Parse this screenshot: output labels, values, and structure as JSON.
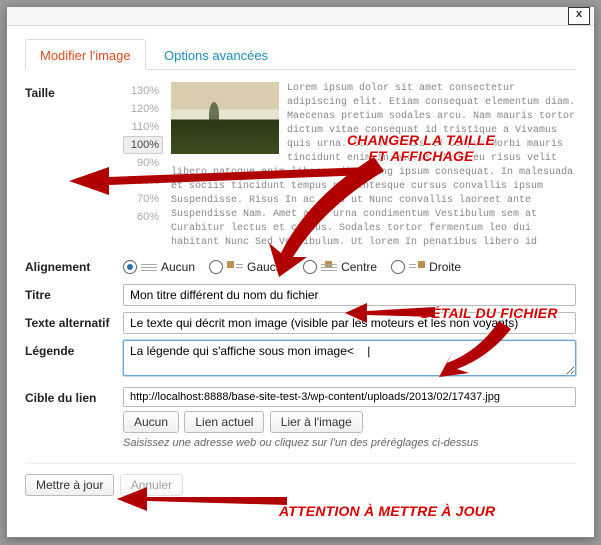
{
  "dialog": {
    "close_label": "x"
  },
  "tabs": {
    "edit": "Modifier l'image",
    "advanced": "Options avancées"
  },
  "taille": {
    "label": "Taille",
    "sizes": [
      "130%",
      "120%",
      "110%",
      "100%",
      "90%",
      "80%",
      "70%",
      "60%"
    ],
    "selected": "100%",
    "lorem": "Lorem ipsum dolor sit amet consectetur adipiscing elit. Etiam consequat elementum diam. Maecenas pretium sodales arcu. Nam mauris tortor dictum vitae consequat id tristique a Vivamus quis urna. Sed et felis id tempus Morbi mauris tincidunt enim In mauris. Pede eu risus velit libero natoque enim libero adipiscing ipsum consequat. In malesuada et sociis tincidunt tempus pellentesque cursus convallis ipsum Suspendisse. Risus In ac quis ut Nunc convallis laoreet ante Suspendisse Nam. Amet amet urna condimentum Vestibulum sem at Curabitur lectus et cursus. Sodales tortor fermentum leo dui habitant Nunc Sed Vestibulum. Ut lorem In penatibus libero id"
  },
  "alignement": {
    "label": "Alignement",
    "options": {
      "none": "Aucun",
      "left": "Gauche",
      "center": "Centre",
      "right": "Droite"
    },
    "selected": "none"
  },
  "titre": {
    "label": "Titre",
    "value": "Mon titre différent du nom du fichier"
  },
  "texte_alt": {
    "label": "Texte alternatif",
    "value": "Le texte qui décrit mon image (visible par les moteurs et les non voyants)"
  },
  "legende": {
    "label": "Légende",
    "value": "La légende qui s'affiche sous mon image<    |"
  },
  "cible": {
    "label": "Cible du lien",
    "value": "http://localhost:8888/base-site-test-3/wp-content/uploads/2013/02/17437.jpg",
    "buttons": {
      "none": "Aucun",
      "current": "Lien actuel",
      "image": "Lier à l'image"
    },
    "helper": "Saisissez une adresse web ou cliquez sur l'un des préréglages ci-dessus"
  },
  "footer": {
    "update": "Mettre à jour",
    "cancel": "Annuler"
  },
  "annotations": {
    "a1": "CHANGER LA TAILLE\nET AFFICHAGE",
    "a2": "DÉTAIL DU FICHIER",
    "a3": "ATTENTION À METTRE À JOUR"
  }
}
